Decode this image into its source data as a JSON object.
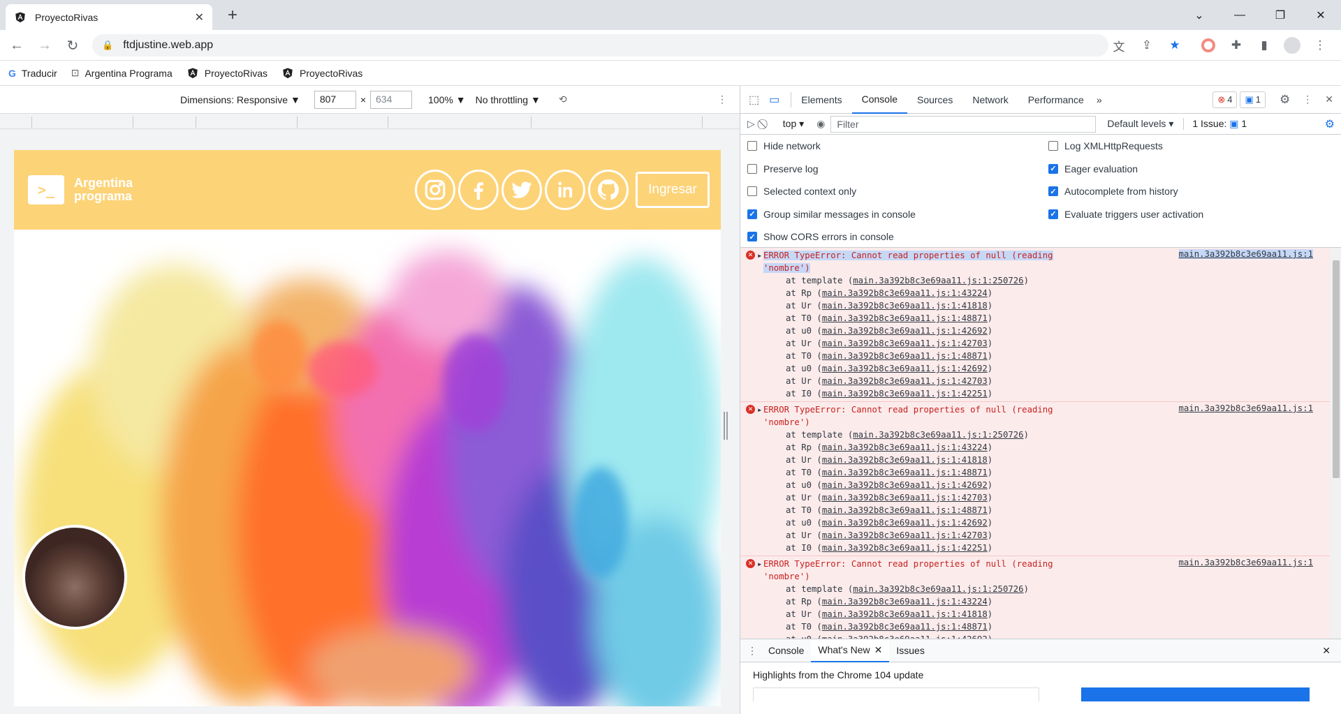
{
  "browser": {
    "tab_title": "ProyectoRivas",
    "url": "ftdjustine.web.app",
    "bookmarks": [
      "Traducir",
      "Argentina Programa",
      "ProyectoRivas",
      "ProyectoRivas"
    ]
  },
  "device_toolbar": {
    "dimensions_label": "Dimensions: Responsive",
    "width": "807",
    "x": "×",
    "height": "634",
    "zoom": "100%",
    "throttling": "No throttling"
  },
  "site": {
    "logo_line1": "Argentina",
    "logo_line2": "programa",
    "logo_glyph": ">_",
    "login_button": "Ingresar",
    "social_icons": [
      "instagram-icon",
      "facebook-icon",
      "twitter-icon",
      "linkedin-icon",
      "github-icon"
    ]
  },
  "devtools": {
    "tabs": [
      "Elements",
      "Console",
      "Sources",
      "Network",
      "Performance"
    ],
    "active_tab": "Console",
    "more_tabs": "»",
    "error_count": "4",
    "message_count": "1",
    "context": "top",
    "filter_placeholder": "Filter",
    "levels": "Default levels",
    "issues_label": "1 Issue:",
    "issues_count": "1",
    "settings_left": [
      {
        "label": "Hide network",
        "checked": false
      },
      {
        "label": "Preserve log",
        "checked": false
      },
      {
        "label": "Selected context only",
        "checked": false
      },
      {
        "label": "Group similar messages in console",
        "checked": true
      },
      {
        "label": "Show CORS errors in console",
        "checked": true
      }
    ],
    "settings_right": [
      {
        "label": "Log XMLHttpRequests",
        "checked": false
      },
      {
        "label": "Eager evaluation",
        "checked": true
      },
      {
        "label": "Autocomplete from history",
        "checked": true
      },
      {
        "label": "Evaluate triggers user activation",
        "checked": true
      }
    ],
    "error_header": "ERROR TypeError: Cannot read properties of null (reading",
    "error_header_2": "'nombre')",
    "error_source": "main.3a392b8c3e69aa11.js:1",
    "stack": [
      {
        "fn": "at template",
        "loc": "main.3a392b8c3e69aa11.js:1:250726"
      },
      {
        "fn": "at Rp",
        "loc": "main.3a392b8c3e69aa11.js:1:43224"
      },
      {
        "fn": "at Ur",
        "loc": "main.3a392b8c3e69aa11.js:1:41818"
      },
      {
        "fn": "at T0",
        "loc": "main.3a392b8c3e69aa11.js:1:48871"
      },
      {
        "fn": "at u0",
        "loc": "main.3a392b8c3e69aa11.js:1:42692"
      },
      {
        "fn": "at Ur",
        "loc": "main.3a392b8c3e69aa11.js:1:42703"
      },
      {
        "fn": "at T0",
        "loc": "main.3a392b8c3e69aa11.js:1:48871"
      },
      {
        "fn": "at u0",
        "loc": "main.3a392b8c3e69aa11.js:1:42692"
      },
      {
        "fn": "at Ur",
        "loc": "main.3a392b8c3e69aa11.js:1:42703"
      },
      {
        "fn": "at I0",
        "loc": "main.3a392b8c3e69aa11.js:1:42251"
      }
    ],
    "drawer_tabs": [
      "Console",
      "What's New",
      "Issues"
    ],
    "drawer_active": "What's New",
    "whats_new_title": "Highlights from the Chrome 104 update"
  }
}
